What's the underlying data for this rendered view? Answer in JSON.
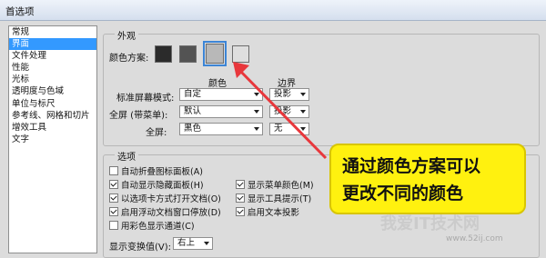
{
  "window": {
    "title": "首选项"
  },
  "sidebar": {
    "items": [
      {
        "label": "常规"
      },
      {
        "label": "界面",
        "selected": true
      },
      {
        "label": "文件处理"
      },
      {
        "label": "性能"
      },
      {
        "label": "光标"
      },
      {
        "label": "透明度与色域"
      },
      {
        "label": "单位与标尺"
      },
      {
        "label": "参考线、网格和切片"
      },
      {
        "label": "增效工具"
      },
      {
        "label": "文字"
      }
    ]
  },
  "appearance": {
    "group_title": "外观",
    "color_scheme_label": "颜色方案:",
    "swatches": [
      "#2b2b2b",
      "#535353",
      "#b8b8b8",
      "#dedede"
    ],
    "selected_swatch": 2,
    "col_color": "颜色",
    "col_border": "边界",
    "rows": [
      {
        "label": "标准屏幕模式:",
        "color": "自定",
        "border": "投影"
      },
      {
        "label": "全屏 (带菜单):",
        "color": "默认",
        "border": "投影"
      },
      {
        "label": "全屏:",
        "color": "黑色",
        "border": "无"
      }
    ]
  },
  "options": {
    "group_title": "选项",
    "left": [
      {
        "label": "自动折叠图标面板(A)",
        "checked": false
      },
      {
        "label": "自动显示隐藏面板(H)",
        "checked": true
      },
      {
        "label": "以选项卡方式打开文档(O)",
        "checked": true
      },
      {
        "label": "启用浮动文档窗口停放(D)",
        "checked": true
      },
      {
        "label": "用彩色显示通道(C)",
        "checked": false
      }
    ],
    "right": [
      {
        "label": "显示菜单颜色(M)",
        "checked": true
      },
      {
        "label": "显示工具提示(T)",
        "checked": true
      },
      {
        "label": "启用文本投影",
        "checked": true
      }
    ],
    "transform_label": "显示变换值(V):",
    "transform_value": "右上"
  },
  "callout": {
    "line1": "通过颜色方案可以",
    "line2": "更改不同的颜色"
  },
  "watermark": {
    "text": "我爱IT技术网",
    "url": "www.52ij.com"
  },
  "colors": {
    "callout": "#fff10f",
    "arrow": "#e8373c",
    "selection": "#3399ff"
  }
}
